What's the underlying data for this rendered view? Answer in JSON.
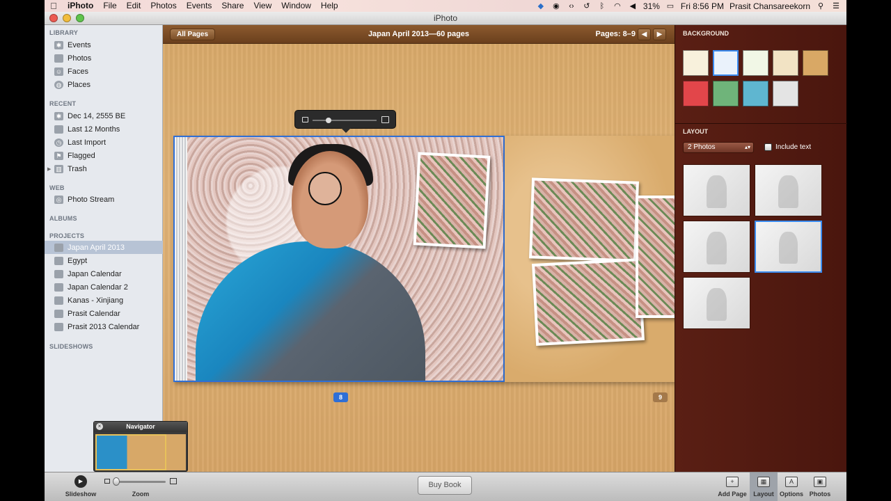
{
  "menubar": {
    "apple": "",
    "items": [
      "iPhoto",
      "File",
      "Edit",
      "Photos",
      "Events",
      "Share",
      "View",
      "Window",
      "Help"
    ],
    "battery": "31%",
    "clock": "Fri 8:56 PM",
    "user": "Prasit Chansareekorn"
  },
  "window": {
    "title": "iPhoto"
  },
  "sidebar": {
    "library_header": "LIBRARY",
    "library": [
      {
        "label": "Events",
        "icon": "events-icon"
      },
      {
        "label": "Photos",
        "icon": "photos-icon"
      },
      {
        "label": "Faces",
        "icon": "faces-icon"
      },
      {
        "label": "Places",
        "icon": "places-icon"
      }
    ],
    "recent_header": "RECENT",
    "recent": [
      {
        "label": "Dec 14, 2555 BE",
        "icon": "event-icon"
      },
      {
        "label": "Last 12 Months",
        "icon": "calendar-icon"
      },
      {
        "label": "Last Import",
        "icon": "import-icon"
      },
      {
        "label": "Flagged",
        "icon": "flag-icon"
      },
      {
        "label": "Trash",
        "icon": "trash-icon"
      }
    ],
    "web_header": "WEB",
    "web": [
      {
        "label": "Photo Stream",
        "icon": "photo-stream-icon"
      }
    ],
    "albums_header": "ALBUMS",
    "projects_header": "PROJECTS",
    "projects": [
      {
        "label": "Japan April 2013",
        "icon": "book-icon",
        "selected": true
      },
      {
        "label": "Egypt",
        "icon": "book-icon"
      },
      {
        "label": "Japan Calendar",
        "icon": "calendar-icon"
      },
      {
        "label": "Japan Calendar 2",
        "icon": "calendar-icon"
      },
      {
        "label": "Kanas - Xinjiang",
        "icon": "book-icon"
      },
      {
        "label": "Prasit Calendar",
        "icon": "calendar-icon"
      },
      {
        "label": "Prasit 2013 Calendar",
        "icon": "calendar-icon"
      }
    ],
    "slideshows_header": "SLIDESHOWS"
  },
  "main": {
    "all_pages": "All Pages",
    "book_title": "Japan April 2013—60 pages",
    "pages_range": "Pages: 8–9",
    "prev_arrow": "◀",
    "next_arrow": "▶",
    "page_left": "8",
    "page_right": "9"
  },
  "navigator": {
    "title": "Navigator",
    "close": "×"
  },
  "rightpanel": {
    "background_header": "BACKGROUND",
    "swatches": [
      "#f8f1dc",
      "#eaf2fb",
      "#f1f7e6",
      "#f2e3c4",
      "#d9a865",
      "#e2464a",
      "#6fb47a",
      "#5fb6d0",
      "#e4e4e4"
    ],
    "selected_swatch": 1,
    "layout_header": "LAYOUT",
    "layout_select": "2 Photos",
    "include_text": "Include text",
    "selected_layout": 3
  },
  "bottombar": {
    "slideshow": "Slideshow",
    "zoom": "Zoom",
    "buy_book": "Buy Book",
    "add_page": "Add Page",
    "layout": "Layout",
    "options": "Options",
    "photos": "Photos"
  }
}
